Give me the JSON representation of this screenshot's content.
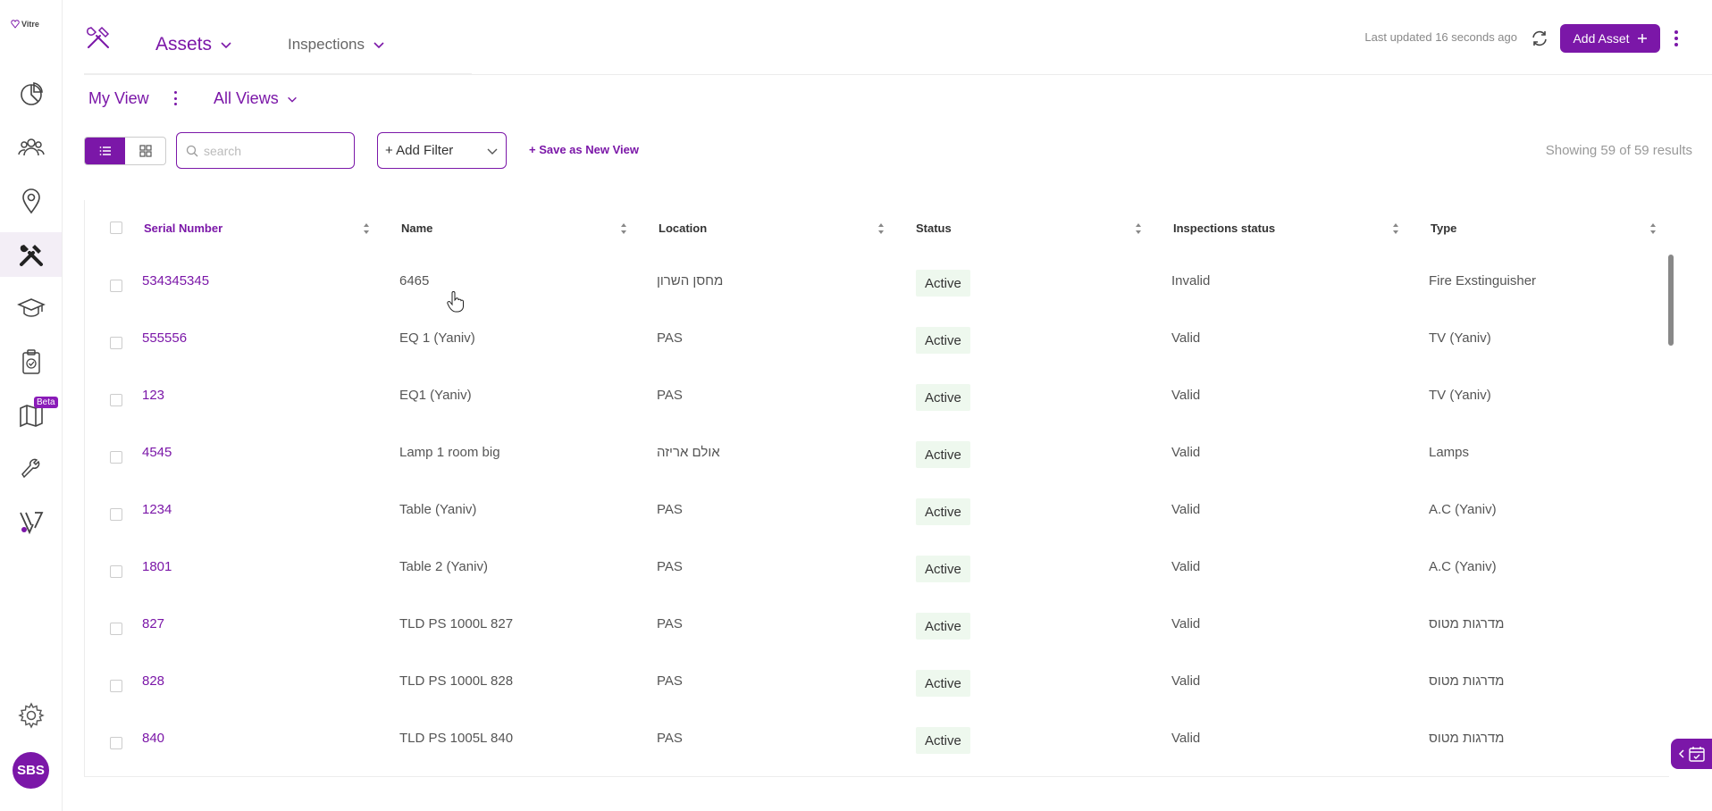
{
  "app": {
    "logo_text": "Vitre",
    "accent_color": "#7b17a8"
  },
  "sidebar": {
    "items": [
      {
        "name": "dashboard",
        "icon": "pie-chart-icon"
      },
      {
        "name": "people",
        "icon": "users-icon"
      },
      {
        "name": "locations",
        "icon": "map-pin-icon"
      },
      {
        "name": "assets",
        "icon": "tools-icon",
        "active": true
      },
      {
        "name": "training",
        "icon": "graduation-cap-icon"
      },
      {
        "name": "checklists",
        "icon": "clipboard-check-icon"
      },
      {
        "name": "maps",
        "icon": "map-icon",
        "badge": "Beta"
      },
      {
        "name": "maintenance",
        "icon": "wrench-icon"
      },
      {
        "name": "vitre",
        "icon": "vitre-logo-icon"
      },
      {
        "name": "settings",
        "icon": "gear-icon"
      }
    ],
    "avatar_initials": "SBS"
  },
  "header": {
    "tabs": [
      {
        "label": "Assets",
        "active": true
      },
      {
        "label": "Inspections",
        "active": false
      }
    ],
    "last_updated_label": "Last updated",
    "last_updated_value": "16 seconds ago",
    "add_asset_label": "Add Asset"
  },
  "views": {
    "my_view_label": "My View",
    "all_views_label": "All Views"
  },
  "toolbar": {
    "search_placeholder": "search",
    "add_filter_label": "+ Add Filter",
    "save_view_label": "+ Save as New View",
    "results_text": "Showing 59 of 59 results"
  },
  "table": {
    "columns": [
      "Serial Number",
      "Name",
      "Location",
      "Status",
      "Inspections status",
      "Type"
    ],
    "rows": [
      {
        "serial": "534345345",
        "name": "6465",
        "location": "מחסן השרון",
        "status": "Active",
        "inspection": "Invalid",
        "type": "Fire Exstinguisher"
      },
      {
        "serial": "555556",
        "name": "EQ 1 (Yaniv)",
        "location": "PAS",
        "status": "Active",
        "inspection": "Valid",
        "type": "TV (Yaniv)"
      },
      {
        "serial": "123",
        "name": "EQ1 (Yaniv)",
        "location": "PAS",
        "status": "Active",
        "inspection": "Valid",
        "type": "TV (Yaniv)"
      },
      {
        "serial": "4545",
        "name": "Lamp 1 room big",
        "location": "אולם אריזה",
        "status": "Active",
        "inspection": "Valid",
        "type": "Lamps"
      },
      {
        "serial": "1234",
        "name": "Table (Yaniv)",
        "location": "PAS",
        "status": "Active",
        "inspection": "Valid",
        "type": "A.C (Yaniv)"
      },
      {
        "serial": "1801",
        "name": "Table 2 (Yaniv)",
        "location": "PAS",
        "status": "Active",
        "inspection": "Valid",
        "type": "A.C (Yaniv)"
      },
      {
        "serial": "827",
        "name": "TLD PS 1000L 827",
        "location": "PAS",
        "status": "Active",
        "inspection": "Valid",
        "type": "מדרגות מטוס"
      },
      {
        "serial": "828",
        "name": "TLD PS 1000L 828",
        "location": "PAS",
        "status": "Active",
        "inspection": "Valid",
        "type": "מדרגות מטוס"
      },
      {
        "serial": "840",
        "name": "TLD PS 1005L 840",
        "location": "PAS",
        "status": "Active",
        "inspection": "Valid",
        "type": "מדרגות מטוס"
      }
    ]
  }
}
